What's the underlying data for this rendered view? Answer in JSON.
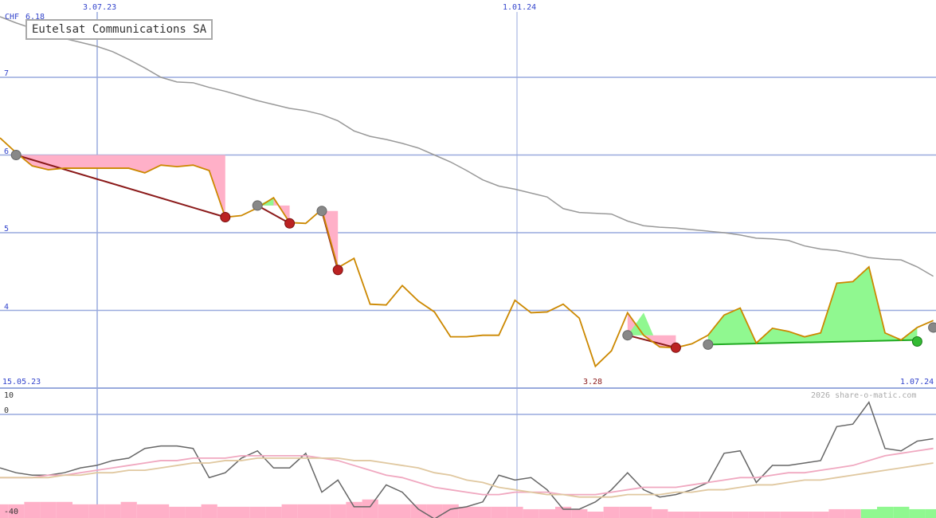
{
  "chart_data": {
    "type": "line",
    "title": "Eutelsat Communications SA",
    "currency_label": "CHF",
    "last_value_label": "6.18",
    "low_label": "3.28",
    "copyright": "2026 share-o-matic.com",
    "x_start_label": "15.05.23",
    "x_end_label": "1.07.24",
    "x_top_ticks": [
      "3.07.23",
      "1.01.24"
    ],
    "y_ticks": [
      "7",
      "6",
      "5",
      "4"
    ],
    "ylim": [
      3.0,
      7.6
    ],
    "grid": true,
    "colors": {
      "price": "#cc8800",
      "ma": "#999999",
      "gain_fill": "#90f890",
      "loss_fill": "#ffb0c8",
      "down_trend": "#8b1a1a",
      "up_trend": "#22aa22",
      "grid": "#99aadd"
    },
    "x_index": [
      0,
      1,
      2,
      3,
      4,
      5,
      6,
      7,
      8,
      9,
      10,
      11,
      12,
      13,
      14,
      15,
      16,
      17,
      18,
      19,
      20,
      21,
      22,
      23,
      24,
      25,
      26,
      27,
      28,
      29,
      30,
      31,
      32,
      33,
      34,
      35,
      36,
      37,
      38,
      39,
      40,
      41,
      42,
      43,
      44,
      45,
      46,
      47,
      48,
      49,
      50,
      51,
      52,
      53,
      54,
      55,
      56,
      57,
      58
    ],
    "series": [
      {
        "name": "Price",
        "values": [
          6.22,
          6.03,
          5.86,
          5.81,
          5.83,
          5.83,
          5.83,
          5.83,
          5.83,
          5.77,
          5.87,
          5.85,
          5.87,
          5.8,
          5.2,
          5.22,
          5.32,
          5.45,
          5.13,
          5.12,
          5.3,
          4.55,
          4.67,
          4.08,
          4.07,
          4.32,
          4.12,
          3.98,
          3.66,
          3.66,
          3.68,
          3.68,
          4.13,
          3.97,
          3.98,
          4.08,
          3.9,
          3.28,
          3.48,
          3.97,
          3.68,
          3.53,
          3.52,
          3.57,
          3.68,
          3.94,
          4.03,
          3.58,
          3.77,
          3.73,
          3.66,
          3.71,
          4.35,
          4.37,
          4.56,
          3.71,
          3.62,
          3.78,
          3.87
        ]
      },
      {
        "name": "Moving average",
        "values": [
          7.78,
          7.7,
          7.63,
          7.57,
          7.5,
          7.45,
          7.4,
          7.33,
          7.23,
          7.12,
          7.0,
          6.94,
          6.93,
          6.87,
          6.82,
          6.76,
          6.7,
          6.65,
          6.6,
          6.57,
          6.52,
          6.44,
          6.31,
          6.24,
          6.2,
          6.15,
          6.09,
          6.0,
          5.91,
          5.8,
          5.68,
          5.6,
          5.56,
          5.51,
          5.46,
          5.31,
          5.26,
          5.25,
          5.24,
          5.15,
          5.09,
          5.07,
          5.06,
          5.04,
          5.02,
          5.0,
          4.97,
          4.93,
          4.92,
          4.9,
          4.83,
          4.79,
          4.77,
          4.73,
          4.68,
          4.66,
          4.65,
          4.56,
          4.44
        ]
      }
    ],
    "signals": [
      {
        "from": 1,
        "to": 14,
        "type": "down",
        "from_value": 6.0,
        "to_value": 5.2
      },
      {
        "from": 16,
        "to": 18,
        "type": "down",
        "from_value": 5.35,
        "to_value": 5.12
      },
      {
        "from": 20,
        "to": 21,
        "type": "down",
        "from_value": 5.28,
        "to_value": 4.52
      },
      {
        "from": 39,
        "to": 42,
        "type": "down",
        "from_value": 3.68,
        "to_value": 3.52
      },
      {
        "from": 44,
        "to": 57,
        "type": "up",
        "from_value": 3.56,
        "to_value": 3.62
      }
    ],
    "markers": [
      {
        "i": 1,
        "v": 6.0,
        "color": "gray"
      },
      {
        "i": 14,
        "v": 5.2,
        "color": "red"
      },
      {
        "i": 16,
        "v": 5.35,
        "color": "gray"
      },
      {
        "i": 18,
        "v": 5.12,
        "color": "red"
      },
      {
        "i": 20,
        "v": 5.28,
        "color": "gray"
      },
      {
        "i": 21,
        "v": 4.52,
        "color": "red"
      },
      {
        "i": 39,
        "v": 3.68,
        "color": "gray"
      },
      {
        "i": 42,
        "v": 3.52,
        "color": "red"
      },
      {
        "i": 44,
        "v": 3.56,
        "color": "gray"
      },
      {
        "i": 57,
        "v": 3.6,
        "color": "green"
      },
      {
        "i": 58,
        "v": 3.78,
        "color": "gray"
      }
    ],
    "oscillator": {
      "y_ticks": [
        "10",
        "0",
        "-40"
      ],
      "ylim": [
        -40,
        10
      ],
      "lines": [
        {
          "name": "Oscillator",
          "color": "#666666",
          "values": [
            -22,
            -24,
            -25,
            -25,
            -24,
            -22,
            -21,
            -19,
            -18,
            -14,
            -13,
            -13,
            -14,
            -26,
            -24,
            -18,
            -15,
            -22,
            -22,
            -16,
            -32,
            -27,
            -38,
            -38,
            -29,
            -32,
            -39,
            -43,
            -39,
            -38,
            -36,
            -25,
            -27,
            -26,
            -31,
            -39,
            -39,
            -36,
            -31,
            -24,
            -31,
            -34,
            -33,
            -31,
            -28,
            -16,
            -15,
            -28,
            -21,
            -21,
            -20,
            -19,
            -5,
            -4,
            5,
            -14,
            -15,
            -11,
            -10
          ]
        },
        {
          "name": "Signal 1",
          "color": "#f0a8c0",
          "values": [
            -26,
            -26,
            -26,
            -25,
            -25,
            -24,
            -23,
            -22,
            -21,
            -20,
            -19,
            -19,
            -18,
            -18,
            -18,
            -17,
            -17,
            -17,
            -17,
            -17,
            -18,
            -19,
            -21,
            -23,
            -25,
            -26,
            -28,
            -30,
            -31,
            -32,
            -33,
            -33,
            -32,
            -32,
            -32,
            -33,
            -33,
            -33,
            -32,
            -31,
            -30,
            -30,
            -30,
            -29,
            -28,
            -27,
            -26,
            -26,
            -25,
            -24,
            -24,
            -23,
            -22,
            -21,
            -19,
            -17,
            -16,
            -15,
            -14
          ]
        },
        {
          "name": "Signal 2",
          "color": "#e0c8a0",
          "values": [
            -26,
            -26,
            -26,
            -26,
            -25,
            -25,
            -24,
            -24,
            -23,
            -23,
            -22,
            -21,
            -20,
            -20,
            -19,
            -19,
            -18,
            -18,
            -18,
            -18,
            -18,
            -18,
            -19,
            -19,
            -20,
            -21,
            -22,
            -24,
            -25,
            -27,
            -28,
            -30,
            -31,
            -32,
            -33,
            -33,
            -34,
            -34,
            -34,
            -33,
            -33,
            -33,
            -32,
            -32,
            -31,
            -31,
            -30,
            -29,
            -29,
            -28,
            -27,
            -27,
            -26,
            -25,
            -24,
            -23,
            -22,
            -21,
            -20
          ]
        }
      ],
      "histogram": [
        -37,
        -37,
        -36,
        -36,
        -36,
        -37,
        -37,
        -37,
        -36,
        -37,
        -37,
        -38,
        -38,
        -37,
        -38,
        -38,
        -38,
        -38,
        -37,
        -37,
        -37,
        -37,
        -36,
        -35,
        -37,
        -37,
        -37,
        -37,
        -37,
        -38,
        -38,
        -38,
        -38,
        -39,
        -39,
        -38,
        -39,
        -40,
        -38,
        -38,
        -38,
        -39,
        -40,
        -40,
        -40,
        -40,
        -40,
        -40,
        -40,
        -40,
        -40,
        -40,
        -39,
        -39,
        -39,
        -38,
        -38,
        -39,
        -39
      ]
    }
  }
}
